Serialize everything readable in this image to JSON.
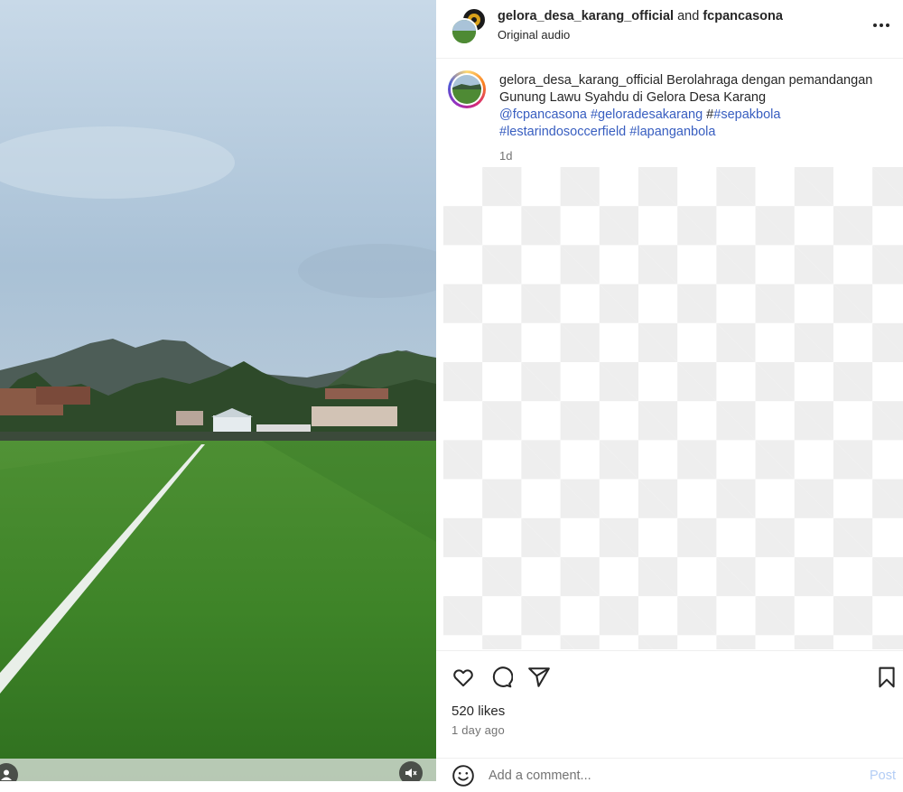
{
  "header": {
    "user1": "gelora_desa_karang_official",
    "conjunction": "and",
    "user2": "fcpancasona",
    "audio": "Original audio"
  },
  "caption": {
    "username": "gelora_desa_karang_official",
    "text": "Berolahraga dengan pemandangan Gunung Lawu Syahdu di Gelora Desa Karang",
    "mention": "@fcpancasona",
    "tag1": "#geloradesakarang",
    "hash_prefix": "#",
    "tag2": "#sepakbola",
    "tag3": "#lestarindosoccerfield",
    "tag4": "#lapanganbola",
    "time": "1d"
  },
  "actions": {
    "likes": "520 likes",
    "date": "1 day ago"
  },
  "comment": {
    "placeholder": "Add a comment...",
    "post_label": "Post"
  },
  "icons": {
    "like": "heart-icon",
    "comment": "comment-bubble-icon",
    "share": "paper-plane-icon",
    "save": "bookmark-icon",
    "more": "more-horizontal-icon",
    "emoji": "emoji-icon",
    "mute": "muted-speaker-icon",
    "tag": "user-tag-icon"
  },
  "colors": {
    "link": "#385ec0",
    "post_disabled": "#b3cdf5",
    "secondary_text": "#737373"
  }
}
